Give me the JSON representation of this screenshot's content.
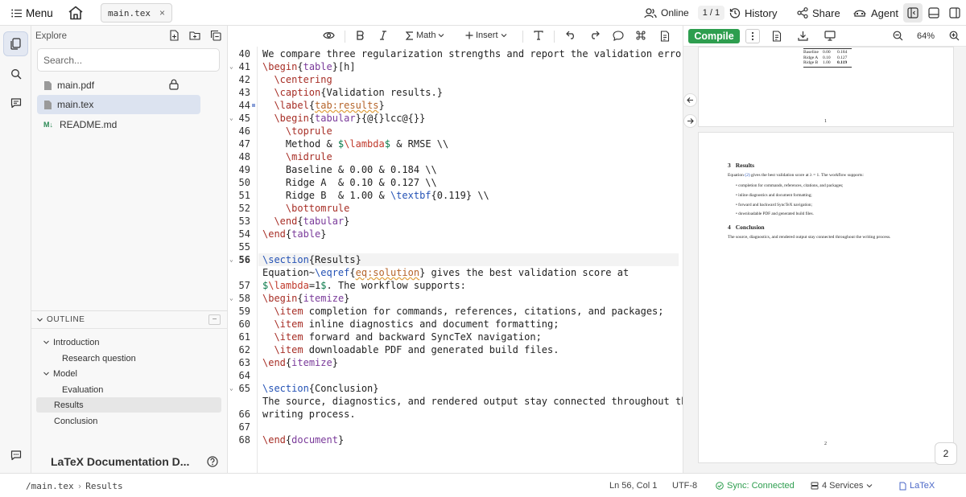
{
  "topbar": {
    "menu_label": "Menu",
    "tab_file": "main.tex",
    "tab_close": "×",
    "online_label": "Online",
    "online_count": "1 / 1",
    "history_label": "History",
    "share_label": "Share",
    "agent_label": "Agent"
  },
  "sidebar": {
    "explore_title": "Explore",
    "search_placeholder": "Search...",
    "files": [
      {
        "name": "main.pdf",
        "icon": "file-icon",
        "locked": true
      },
      {
        "name": "main.tex",
        "icon": "file-icon",
        "selected": true
      },
      {
        "name": "README.md",
        "icon": "markdown-icon",
        "badge": "M↓"
      }
    ],
    "outline_title": "OUTLINE",
    "outline_collapse": "−",
    "outline": [
      {
        "label": "Introduction",
        "expanded": true
      },
      {
        "label": "Research question"
      },
      {
        "label": "Model",
        "expanded": true
      },
      {
        "label": "Evaluation"
      },
      {
        "label": "Results",
        "selected": true
      },
      {
        "label": "Conclusion"
      }
    ],
    "project_title": "LaTeX Documentation D..."
  },
  "editor": {
    "toolbar": {
      "math_label": "Math",
      "insert_label": "Insert"
    },
    "line_numbers": [
      "40",
      "41",
      "42",
      "43",
      "44",
      "45",
      "46",
      "47",
      "48",
      "49",
      "50",
      "51",
      "52",
      "53",
      "54",
      "55",
      "56",
      "",
      "57",
      "58",
      "59",
      "60",
      "61",
      "62",
      "63",
      "64",
      "65",
      "",
      "66",
      "67",
      "68"
    ],
    "current_line": "56",
    "lines": [
      "We compare three regularization strengths and report the validation error.",
      "\\begin{table}[h]",
      "  \\centering",
      "  \\caption{Validation results.}",
      "  \\label{tab:results}",
      "  \\begin{tabular}{@{}lcc@{}}",
      "    \\toprule",
      "    Method & $\\lambda$ & RMSE \\\\",
      "    \\midrule",
      "    Baseline & 0.00 & 0.184 \\\\",
      "    Ridge A  & 0.10 & 0.127 \\\\",
      "    Ridge B  & 1.00 & \\textbf{0.119} \\\\",
      "    \\bottomrule",
      "  \\end{tabular}",
      "\\end{table}",
      "",
      "\\section{Results}",
      "Equation~\\eqref{eq:solution} gives the best validation score at",
      "$\\lambda=1$. The workflow supports:",
      "\\begin{itemize}",
      "  \\item completion for commands, references, citations, and packages;",
      "  \\item inline diagnostics and document formatting;",
      "  \\item forward and backward SyncTeX navigation;",
      "  \\item downloadable PDF and generated build files.",
      "\\end{itemize}",
      "",
      "\\section{Conclusion}",
      "The source, diagnostics, and rendered output stay connected throughout the",
      "writing process.",
      "",
      "\\end{document}"
    ]
  },
  "pdf": {
    "compile_label": "Compile",
    "zoom": "64%",
    "page1": {
      "table_rows": [
        [
          "Baseline",
          "0.00",
          "0.184"
        ],
        [
          "Ridge A",
          "0.10",
          "0.127"
        ],
        [
          "Ridge B",
          "1.00",
          "0.119"
        ]
      ],
      "page_number": "1"
    },
    "page2": {
      "section3_num": "3",
      "section3_title": "Results",
      "body_prefix": "Equation",
      "eq_ref": "(2)",
      "body_suffix": "gives the best validation score at λ = 1. The workflow supports:",
      "bullets": [
        "completion for commands, references, citations, and packages;",
        "inline diagnostics and document formatting;",
        "forward and backward SyncTeX navigation;",
        "downloadable PDF and generated build files."
      ],
      "section4_num": "4",
      "section4_title": "Conclusion",
      "conclusion_text": "The source, diagnostics, and rendered output stay connected throughout the writing process.",
      "page_number": "2"
    },
    "page_badge": "2"
  },
  "statusbar": {
    "path": "/main.tex",
    "separator": "›",
    "section": "Results",
    "cursor": "Ln 56, Col 1",
    "encoding": "UTF-8",
    "sync": "Sync: Connected",
    "services": "4 Services",
    "language": "LaTeX"
  }
}
